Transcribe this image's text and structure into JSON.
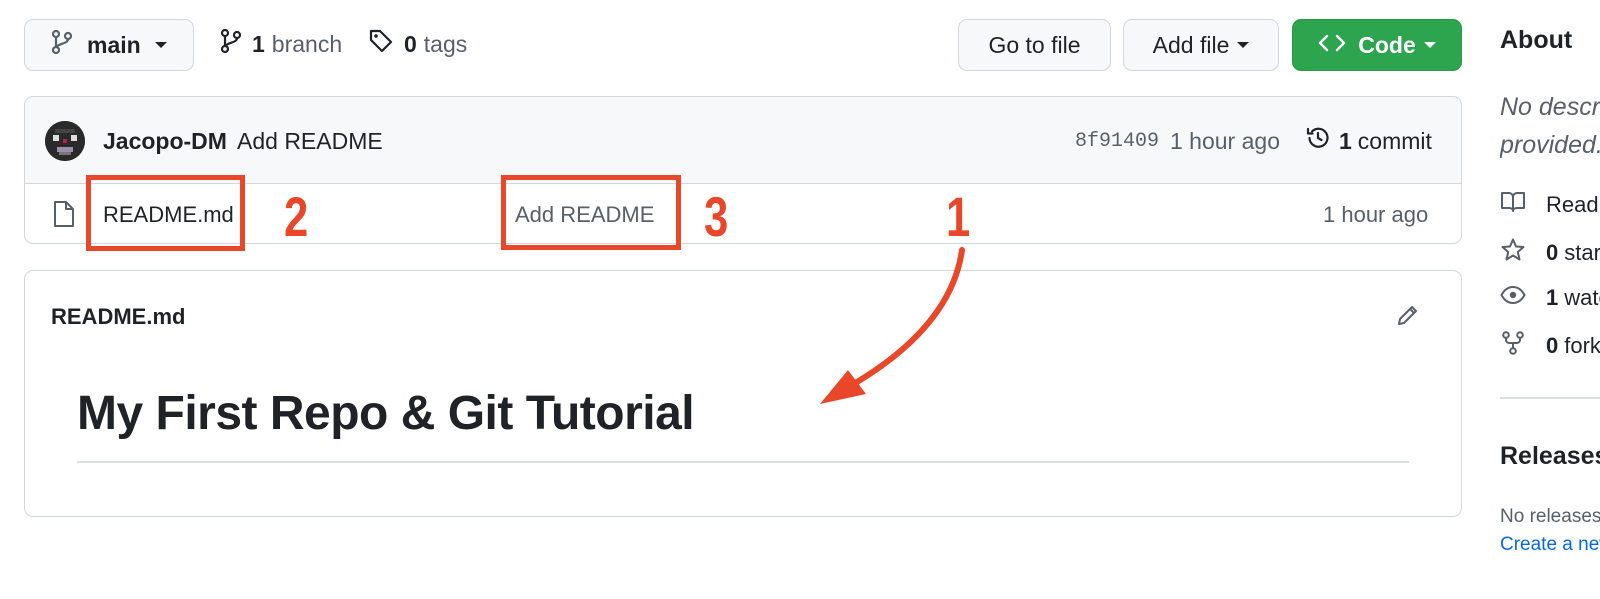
{
  "toolbar": {
    "branch_label": "main",
    "branches_count": "1",
    "branches_label": "branch",
    "tags_count": "0",
    "tags_label": "tags",
    "goto_label": "Go to file",
    "addfile_label": "Add file",
    "code_label": "Code"
  },
  "commit": {
    "author": "Jacopo-DM",
    "message": "Add README",
    "sha": "8f91409",
    "time": "1 hour ago",
    "count": "1",
    "count_label": "commit"
  },
  "files": [
    {
      "name": "README.md",
      "message": "Add README",
      "time": "1 hour ago"
    }
  ],
  "readme": {
    "title": "README.md",
    "heading": "My First Repo & Git Tutorial"
  },
  "sidebar": {
    "about_heading": "About",
    "desc_line1": "No description, website, or topics",
    "desc_line2": "provided.",
    "readme_label": "Readme",
    "stars_count": "0",
    "stars_label": "stars",
    "watching_count": "1",
    "watching_label": "watching",
    "forks_count": "0",
    "forks_label": "forks",
    "releases_heading": "Releases",
    "releases_none": "No releases published",
    "releases_create": "Create a new release"
  },
  "annotations": {
    "n1": "1",
    "n2": "2",
    "n3": "3",
    "color": "#e8472a"
  },
  "colors": {
    "code_button": "#2da44e",
    "border": "#d0d7de",
    "muted_text": "#57606a",
    "link": "#0969da"
  }
}
